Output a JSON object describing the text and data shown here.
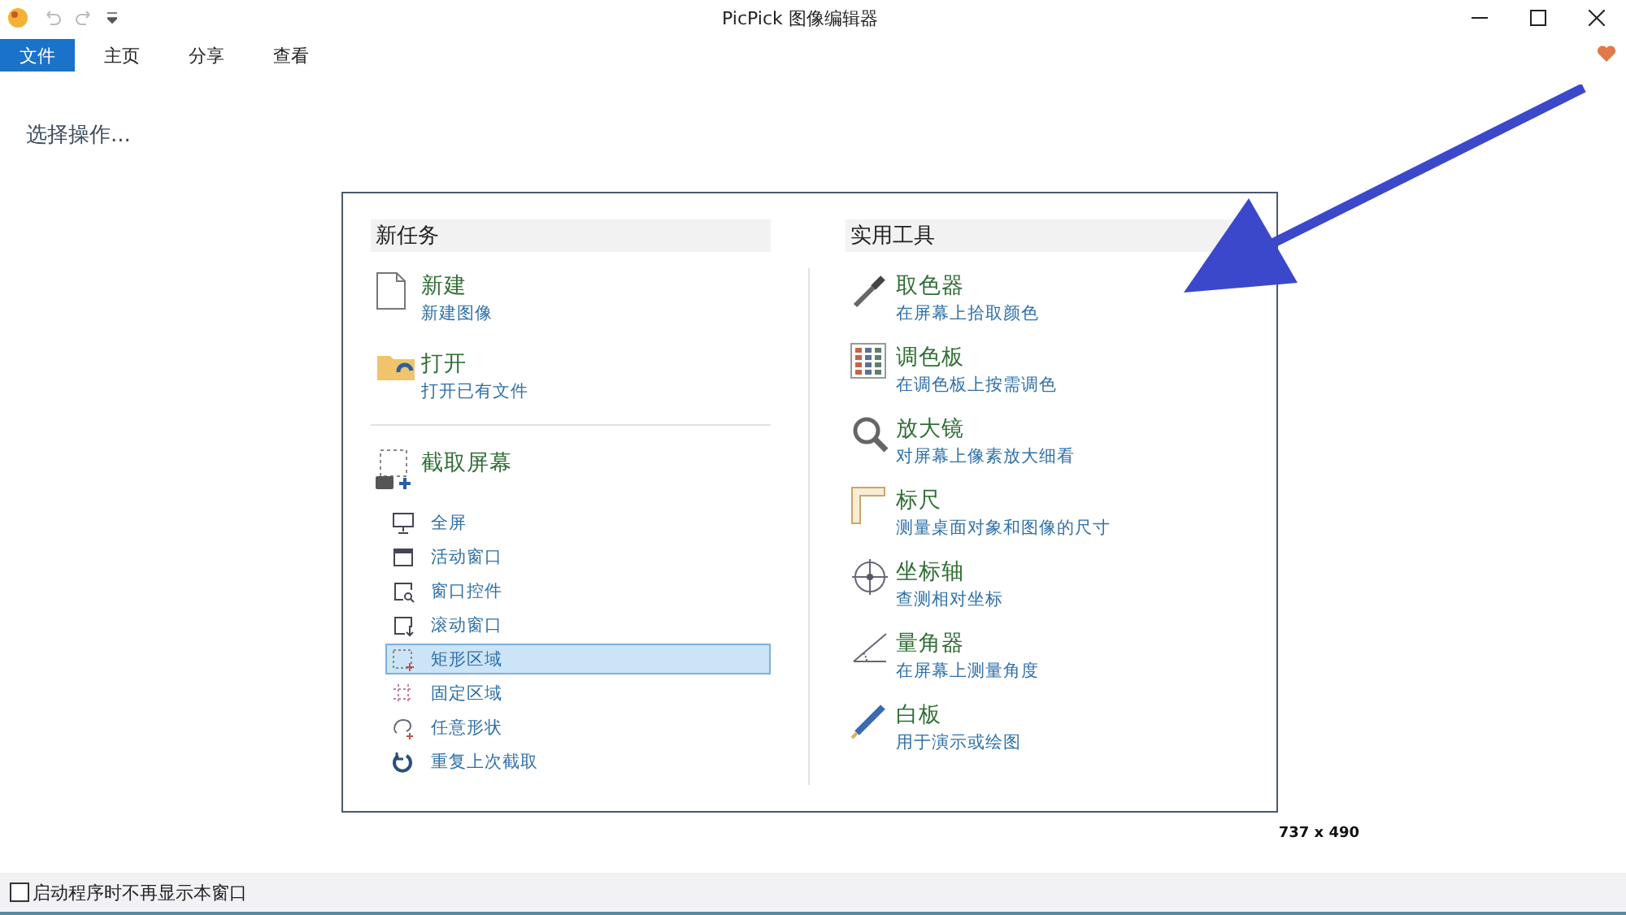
{
  "window": {
    "title": "PicPick 图像编辑器"
  },
  "menu_tabs": [
    {
      "label": "文件",
      "selected": true
    },
    {
      "label": "主页",
      "selected": false
    },
    {
      "label": "分享",
      "selected": false
    },
    {
      "label": "查看",
      "selected": false
    }
  ],
  "prompt": "选择操作...",
  "new_task": {
    "header": "新任务",
    "items": [
      {
        "kind": "file",
        "title": "新建",
        "subtitle": "新建图像"
      },
      {
        "kind": "folder",
        "title": "打开",
        "subtitle": "打开已有文件"
      }
    ],
    "capture": {
      "title": "截取屏幕",
      "items": [
        {
          "kind": "monitor",
          "label": "全屏",
          "selected": false
        },
        {
          "kind": "window",
          "label": "活动窗口",
          "selected": false
        },
        {
          "kind": "control",
          "label": "窗口控件",
          "selected": false
        },
        {
          "kind": "scroll",
          "label": "滚动窗口",
          "selected": false
        },
        {
          "kind": "rect",
          "label": "矩形区域",
          "selected": true
        },
        {
          "kind": "fixed",
          "label": "固定区域",
          "selected": false
        },
        {
          "kind": "free",
          "label": "任意形状",
          "selected": false
        },
        {
          "kind": "repeat",
          "label": "重复上次截取",
          "selected": false
        }
      ]
    }
  },
  "tools": {
    "header": "实用工具",
    "items": [
      {
        "kind": "picker",
        "title": "取色器",
        "subtitle": "在屏幕上拾取颜色"
      },
      {
        "kind": "palette",
        "title": "调色板",
        "subtitle": "在调色板上按需调色"
      },
      {
        "kind": "magnifier",
        "title": "放大镜",
        "subtitle": "对屏幕上像素放大细看"
      },
      {
        "kind": "ruler",
        "title": "标尺",
        "subtitle": "测量桌面对象和图像的尺寸"
      },
      {
        "kind": "crosshair",
        "title": "坐标轴",
        "subtitle": "查测相对坐标"
      },
      {
        "kind": "protractor",
        "title": "量角器",
        "subtitle": "在屏幕上测量角度"
      },
      {
        "kind": "whiteboard",
        "title": "白板",
        "subtitle": "用于演示或绘图"
      }
    ]
  },
  "size_label": "737 x 490",
  "startup_checkbox": {
    "label": "启动程序时不再显示本窗口",
    "checked": false
  }
}
